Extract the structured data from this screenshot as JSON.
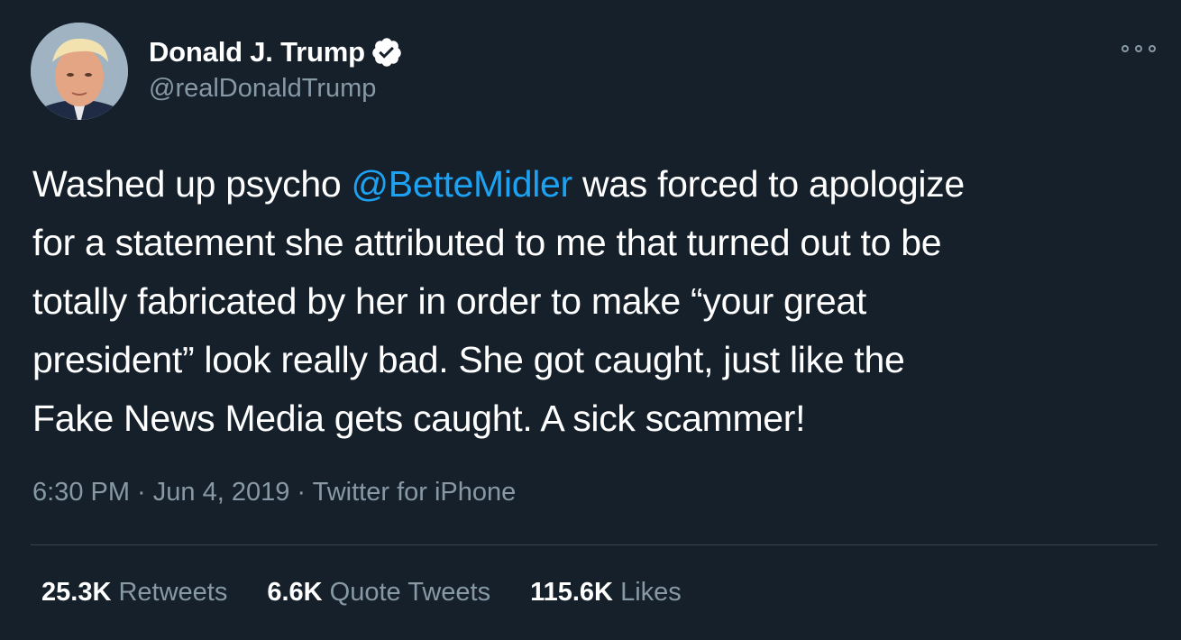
{
  "author": {
    "display_name": "Donald J. Trump",
    "handle": "@realDonaldTrump",
    "verified": true
  },
  "icons": {
    "verified": "verified-badge-icon",
    "more": "more-options-icon"
  },
  "tweet": {
    "lines": [
      {
        "before": "Washed up psycho ",
        "mention": "@BetteMidler",
        "after": " was forced to apologize"
      },
      {
        "text": "for a statement she attributed to me that turned out to be"
      },
      {
        "text": "totally fabricated by her in order to make “your great"
      },
      {
        "text": "president” look really bad. She got caught, just like the"
      },
      {
        "text": "Fake News Media gets caught. A sick scammer!"
      }
    ]
  },
  "meta": {
    "time": "6:30 PM",
    "separator": " · ",
    "date": "Jun 4, 2019",
    "source": "Twitter for iPhone"
  },
  "stats": {
    "retweets": {
      "count": "25.3K",
      "label": "Retweets"
    },
    "quote_tweets": {
      "count": "6.6K",
      "label": "Quote Tweets"
    },
    "likes": {
      "count": "115.6K",
      "label": "Likes"
    }
  },
  "colors": {
    "background": "#15202b",
    "text": "#ffffff",
    "secondary": "#8899a6",
    "accent": "#1da1f2",
    "divider": "#38444d"
  }
}
